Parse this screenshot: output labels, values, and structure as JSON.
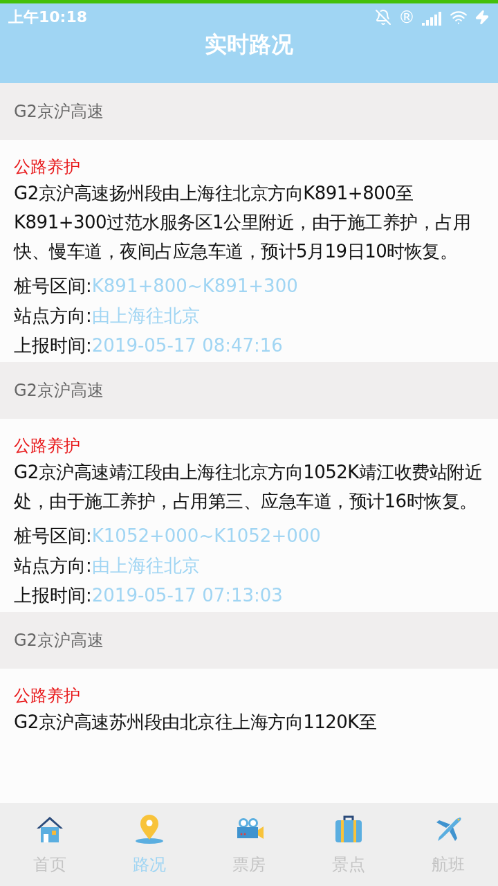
{
  "status_bar": {
    "time": "上午10:18",
    "mark": "®"
  },
  "header": {
    "title": "实时路况"
  },
  "sections": [
    {
      "road": "G2京沪高速",
      "category": "公路养护",
      "description": "G2京沪高速扬州段由上海往北京方向K891+800至K891+300过范水服务区1公里附近，由于施工养护，占用快、慢车道，夜间占应急车道，预计5月19日10时恢复。",
      "fields": [
        {
          "label": "桩号区间:",
          "value": "K891+800~K891+300"
        },
        {
          "label": "站点方向:",
          "value": "由上海往北京"
        },
        {
          "label": "上报时间:",
          "value": "2019-05-17 08:47:16"
        }
      ]
    },
    {
      "road": "G2京沪高速",
      "category": "公路养护",
      "description": "G2京沪高速靖江段由上海往北京方向1052K靖江收费站附近处，由于施工养护，占用第三、应急车道，预计16时恢复。",
      "fields": [
        {
          "label": "桩号区间:",
          "value": "K1052+000~K1052+000"
        },
        {
          "label": "站点方向:",
          "value": "由上海往北京"
        },
        {
          "label": "上报时间:",
          "value": "2019-05-17 07:13:03"
        }
      ]
    },
    {
      "road": "G2京沪高速",
      "category": "公路养护",
      "description": "G2京沪高速苏州段由北京往上海方向1120K至"
    }
  ],
  "nav": [
    {
      "label": "首页",
      "kind": "home",
      "selected": false
    },
    {
      "label": "路况",
      "kind": "pin",
      "selected": true
    },
    {
      "label": "票房",
      "kind": "camera",
      "selected": false
    },
    {
      "label": "景点",
      "kind": "suitcase",
      "selected": false
    },
    {
      "label": "航班",
      "kind": "plane",
      "selected": false
    }
  ]
}
